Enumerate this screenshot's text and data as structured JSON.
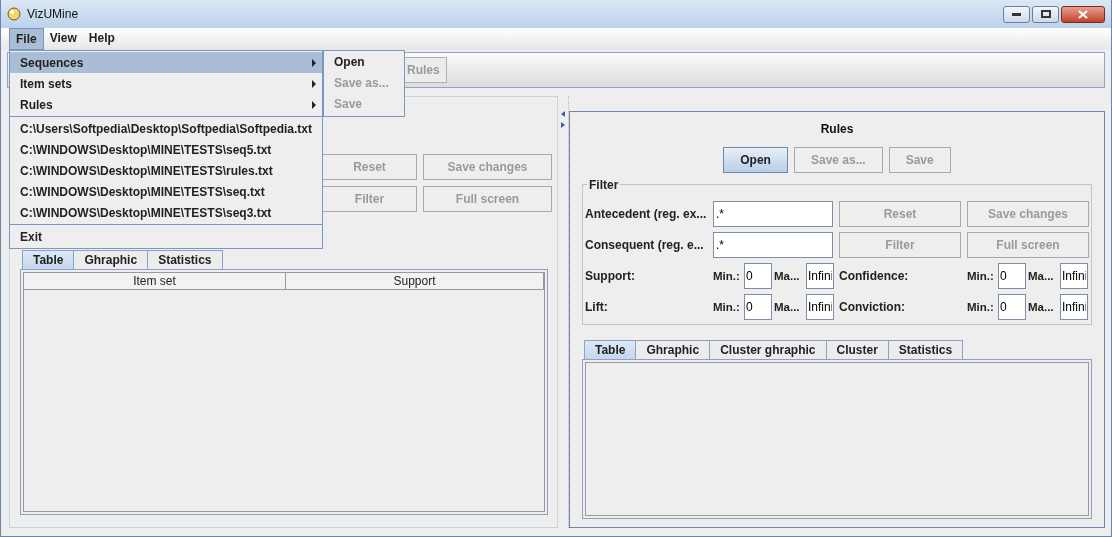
{
  "window": {
    "title": "VizUMine"
  },
  "menubar": [
    {
      "label": "File",
      "selected": true
    },
    {
      "label": "View",
      "selected": false
    },
    {
      "label": "Help",
      "selected": false
    }
  ],
  "file_menu": {
    "sections": [
      [
        {
          "label": "Sequences",
          "kind": "submenu",
          "selected": true
        },
        {
          "label": "Item sets",
          "kind": "submenu",
          "selected": false
        },
        {
          "label": "Rules",
          "kind": "submenu",
          "selected": false
        }
      ],
      [
        {
          "label": "C:\\Users\\Softpedia\\Desktop\\Softpedia\\Softpedia.txt",
          "kind": "item",
          "selected": false
        },
        {
          "label": "C:\\WINDOWS\\Desktop\\MINE\\TESTS\\seq5.txt",
          "kind": "item",
          "selected": false
        },
        {
          "label": "C:\\WINDOWS\\Desktop\\MINE\\TESTS\\rules.txt",
          "kind": "item",
          "selected": false
        },
        {
          "label": "C:\\WINDOWS\\Desktop\\MINE\\TESTS\\seq.txt",
          "kind": "item",
          "selected": false
        },
        {
          "label": "C:\\WINDOWS\\Desktop\\MINE\\TESTS\\seq3.txt",
          "kind": "item",
          "selected": false
        }
      ],
      [
        {
          "label": "Exit",
          "kind": "item",
          "selected": false
        }
      ]
    ]
  },
  "submenu": {
    "items": [
      {
        "label": "Open",
        "disabled": false
      },
      {
        "label": "Save as...",
        "disabled": true
      },
      {
        "label": "Save",
        "disabled": true
      }
    ]
  },
  "toolbar": {
    "buttons": [
      {
        "label": "Rules",
        "disabled": true
      }
    ]
  },
  "left_panel": {
    "buttons": [
      {
        "label": "Reset",
        "disabled": true
      },
      {
        "label": "Save changes",
        "disabled": true
      },
      {
        "label": "Filter",
        "disabled": true
      },
      {
        "label": "Full screen",
        "disabled": true
      }
    ],
    "tabs": [
      {
        "label": "Table",
        "selected": true
      },
      {
        "label": "Ghraphic",
        "selected": false
      },
      {
        "label": "Statistics",
        "selected": false
      }
    ],
    "table": {
      "columns": [
        "Item set",
        "Support"
      ]
    }
  },
  "right_panel": {
    "title": "Rules",
    "file_buttons": [
      {
        "label": "Open",
        "disabled": false
      },
      {
        "label": "Save as...",
        "disabled": true
      },
      {
        "label": "Save",
        "disabled": true
      }
    ],
    "filter": {
      "title": "Filter",
      "regex_fields": [
        {
          "label": "Antecedent (reg. ex...",
          "value": ".*"
        },
        {
          "label": "Consequent (reg. e...",
          "value": ".*"
        }
      ],
      "buttons": [
        {
          "label": "Reset",
          "disabled": true
        },
        {
          "label": "Save changes",
          "disabled": true
        },
        {
          "label": "Filter",
          "disabled": true
        },
        {
          "label": "Full screen",
          "disabled": true
        }
      ],
      "ranges": [
        {
          "label": "Support:",
          "min_label": "Min.:",
          "min": "0",
          "max_label": "Ma...",
          "max": "Infini"
        },
        {
          "label": "Confidence:",
          "min_label": "Min.:",
          "min": "0",
          "max_label": "Ma...",
          "max": "Infini"
        },
        {
          "label": "Lift:",
          "min_label": "Min.:",
          "min": "0",
          "max_label": "Ma...",
          "max": "Infini"
        },
        {
          "label": "Conviction:",
          "min_label": "Min.:",
          "min": "0",
          "max_label": "Ma...",
          "max": "Infini"
        }
      ]
    },
    "tabs": [
      {
        "label": "Table",
        "selected": true
      },
      {
        "label": "Ghraphic",
        "selected": false
      },
      {
        "label": "Cluster ghraphic",
        "selected": false
      },
      {
        "label": "Cluster",
        "selected": false
      },
      {
        "label": "Statistics",
        "selected": false
      }
    ]
  }
}
